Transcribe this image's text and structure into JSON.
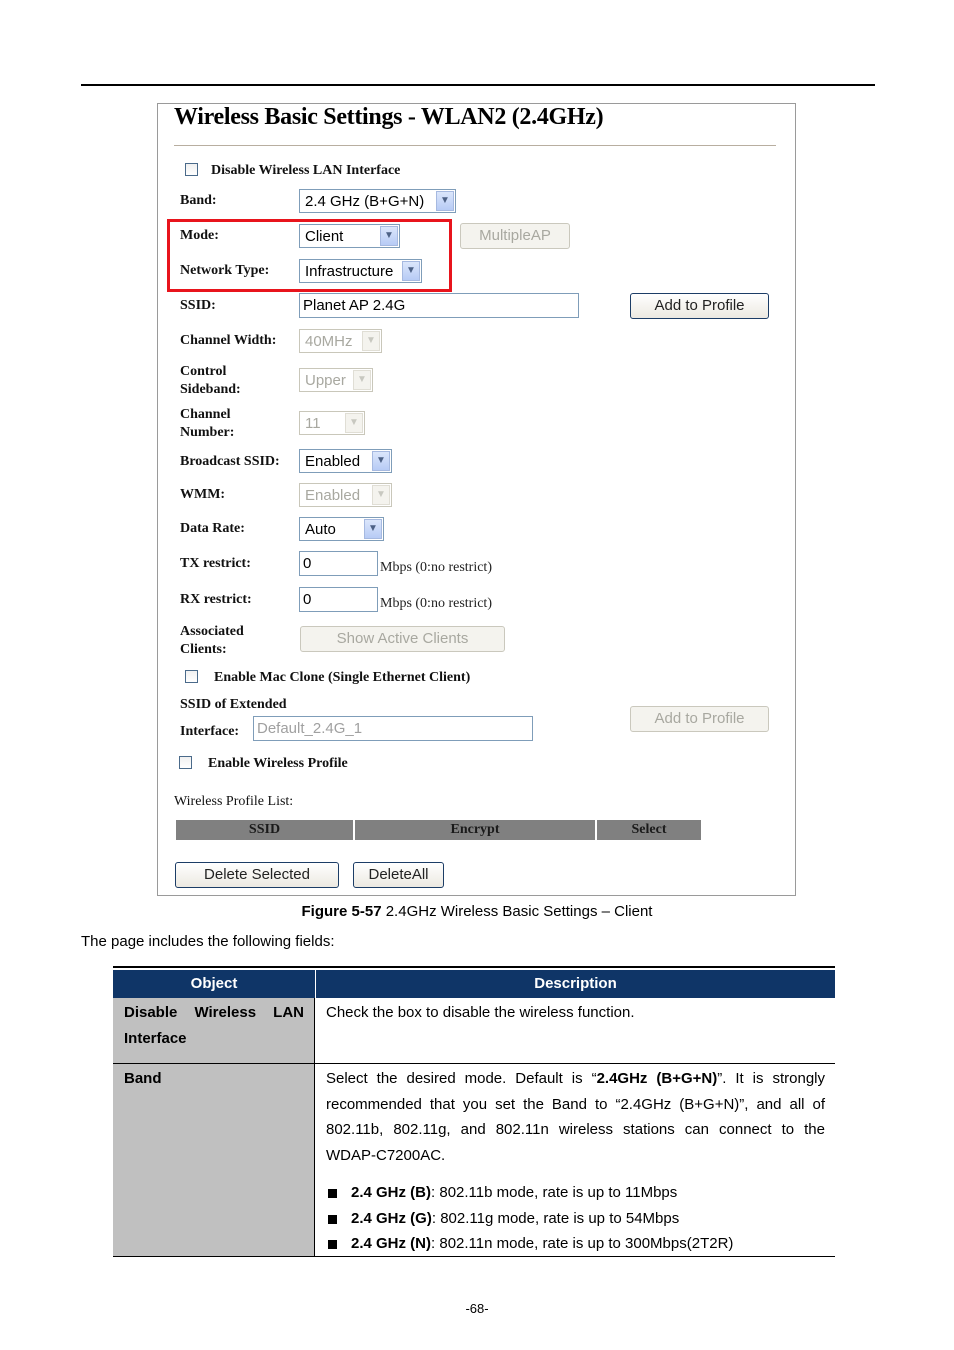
{
  "figure": {
    "title": "Wireless Basic Settings - WLAN2 (2.4GHz)",
    "disable_wlan": {
      "label": "Disable Wireless LAN Interface",
      "checked": false
    },
    "band": {
      "label": "Band:",
      "value": "2.4 GHz (B+G+N)"
    },
    "mode": {
      "label": "Mode:",
      "value": "Client",
      "multiple_ap_button": "MultipleAP"
    },
    "network_type": {
      "label": "Network Type:",
      "value": "Infrastructure"
    },
    "ssid": {
      "label": "SSID:",
      "value": "Planet AP 2.4G",
      "add_profile_button": "Add to Profile"
    },
    "channel_width": {
      "label": "Channel Width:",
      "value": "40MHz"
    },
    "control_sideband": {
      "label_line1": "Control",
      "label_line2": "Sideband:",
      "value": "Upper"
    },
    "channel_number": {
      "label_line1": "Channel",
      "label_line2": "Number:",
      "value": "11"
    },
    "broadcast_ssid": {
      "label": "Broadcast SSID:",
      "value": "Enabled"
    },
    "wmm": {
      "label": "WMM:",
      "value": "Enabled"
    },
    "data_rate": {
      "label": "Data Rate:",
      "value": "Auto"
    },
    "tx_restrict": {
      "label": "TX restrict:",
      "value": "0",
      "hint": "Mbps (0:no restrict)"
    },
    "rx_restrict": {
      "label": "RX restrict:",
      "value": "0",
      "hint": "Mbps (0:no restrict)"
    },
    "associated_clients": {
      "label_line1": "Associated",
      "label_line2": "Clients:",
      "button": "Show Active Clients"
    },
    "mac_clone": {
      "label": "Enable Mac Clone (Single Ethernet Client)",
      "checked": false
    },
    "ssid_extended": {
      "label_line1": "SSID of Extended",
      "label_line2": "Interface:",
      "value": "Default_2.4G_1",
      "add_profile_button": "Add to Profile"
    },
    "enable_profile": {
      "label": "Enable Wireless Profile",
      "checked": false
    },
    "profile_list": {
      "label": "Wireless Profile List:",
      "columns": [
        "SSID",
        "Encrypt",
        "Select"
      ],
      "rows": []
    },
    "delete_selected_button": "Delete Selected",
    "delete_all_button": "DeleteAll",
    "highlight_color": "#e8141c"
  },
  "caption": {
    "number": "Figure 5-57",
    "text": " 2.4GHz Wireless Basic Settings – Client"
  },
  "intro": "The page includes the following fields:",
  "table": {
    "header": {
      "object": "Object",
      "description": "Description",
      "color": "#0f3567"
    },
    "rows": [
      {
        "object": "Disable Wireless LAN Interface",
        "description": "Check the box to disable the wireless function."
      },
      {
        "object": "Band",
        "description_pre": "Select the desired mode. Default is “",
        "description_bold": "2.4GHz (B+G+N)",
        "description_post": "”. It is strongly recommended that you set the Band to “2.4GHz (B+G+N)”, and all of 802.11b, 802.11g, and 802.11n wireless stations can connect to the WDAP-C7200AC.",
        "bullets": [
          {
            "term": "2.4 GHz (B)",
            "text": ": 802.11b mode, rate is up to 11Mbps"
          },
          {
            "term": "2.4 GHz (G)",
            "text": ": 802.11g mode, rate is up to 54Mbps"
          },
          {
            "term": "2.4 GHz (N)",
            "text": ": 802.11n mode, rate is up to 300Mbps(2T2R)"
          }
        ]
      }
    ]
  },
  "page_number": "-68-"
}
